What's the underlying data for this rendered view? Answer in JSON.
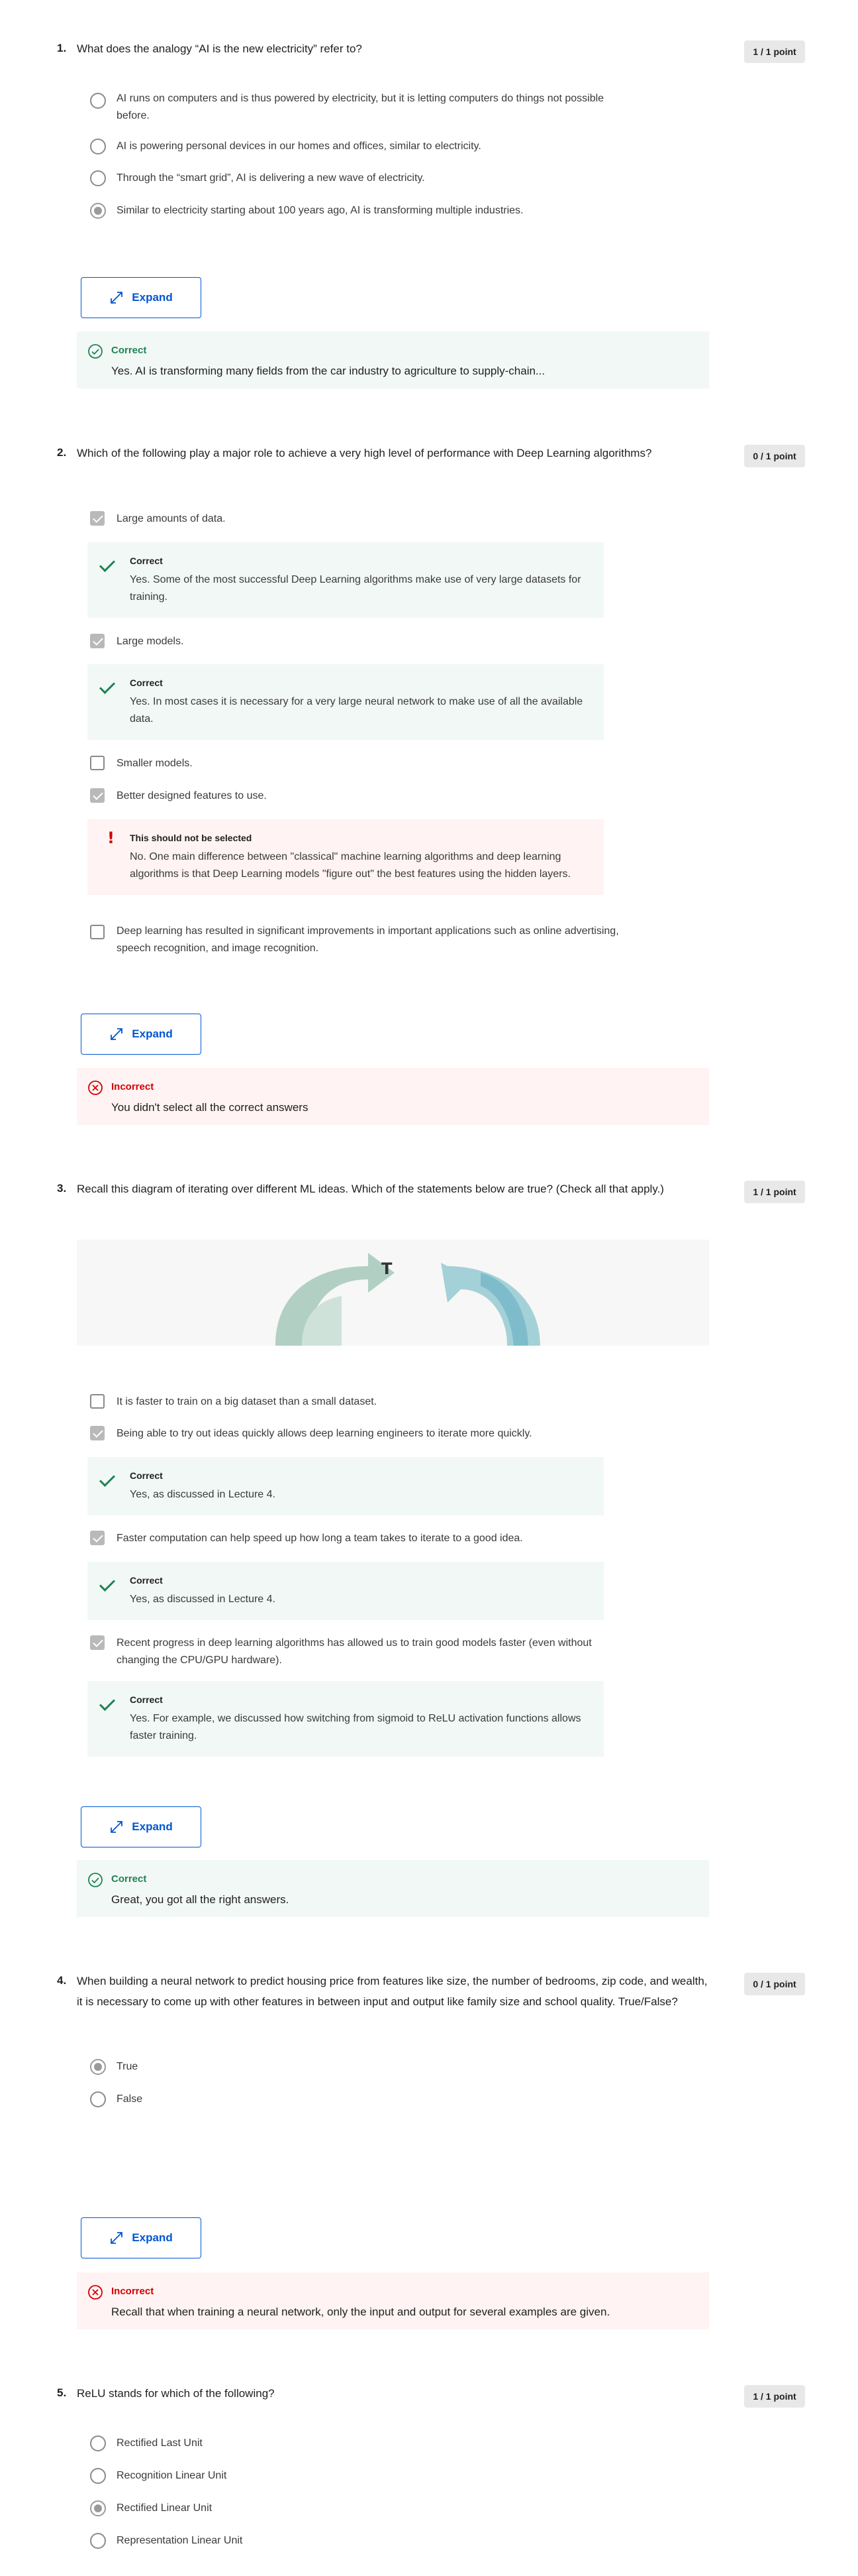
{
  "questions": [
    {
      "number": "1.",
      "text": "What does the analogy “AI is the new electricity” refer to?",
      "points": "1 / 1 point",
      "options": [
        "AI runs on computers and is thus powered by electricity, but it is letting computers do things not possible before.",
        "AI is powering personal devices in our homes and offices, similar to electricity.",
        "Through the “smart grid”, AI is delivering a new wave of electricity.",
        "Similar to electricity starting about 100 years ago, AI is transforming multiple industries."
      ],
      "expand_label": "Expand",
      "result_title": "Correct",
      "result_text": "Yes. AI is transforming many fields from the car industry to agriculture to supply-chain..."
    },
    {
      "number": "2.",
      "text": "Which of the following play a major role to achieve a very high level of performance with Deep Learning algorithms?",
      "points": "0 / 1 point",
      "options": [
        "Large amounts of data.",
        "Large models.",
        "Smaller models.",
        "Better designed features to use.",
        "Deep learning has resulted in significant improvements in important applications such as online advertising, speech recognition, and image recognition."
      ],
      "feedback": [
        {
          "title": "Correct",
          "text": "Yes. Some of the most successful Deep Learning algorithms make use of very large datasets for training."
        },
        {
          "title": "Correct",
          "text": "Yes. In most cases it is necessary for a very large neural network to make use of all the available data."
        },
        {
          "title": "This should not be selected",
          "text": "No. One main difference between \"classical\" machine learning algorithms and deep learning algorithms is that Deep Learning models \"figure out\" the best features using the hidden layers."
        }
      ],
      "expand_label": "Expand",
      "result_title": "Incorrect",
      "result_text": "You didn't select all the correct answers"
    },
    {
      "number": "3.",
      "text": "Recall this diagram of iterating over different ML ideas. Which of the statements below are true? (Check all that apply.)",
      "points": "1 / 1 point",
      "diagram_glyph": "T",
      "options": [
        "It is faster to train on a big dataset than a small dataset.",
        "Being able to try out ideas quickly allows deep learning engineers to iterate more quickly.",
        "Faster computation can help speed up how long a team takes to iterate to a good idea.",
        "Recent progress in deep learning algorithms has allowed us to train good models faster (even without changing the CPU/GPU hardware)."
      ],
      "feedback": [
        {
          "title": "Correct",
          "text": "Yes, as discussed in Lecture 4."
        },
        {
          "title": "Correct",
          "text": "Yes, as discussed in Lecture 4."
        },
        {
          "title": "Correct",
          "text": "Yes. For example, we discussed how switching from sigmoid to ReLU activation functions allows faster training."
        }
      ],
      "expand_label": "Expand",
      "result_title": "Correct",
      "result_text": "Great, you got all the right answers."
    },
    {
      "number": "4.",
      "text": "When building a neural network to predict housing price from features like size, the number of bedrooms, zip code, and wealth, it is necessary to come up with other features in between input and output like family size and school quality. True/False?",
      "points": "0 / 1 point",
      "options": [
        "True",
        "False"
      ],
      "expand_label": "Expand",
      "result_title": "Incorrect",
      "result_text": "Recall that when training a neural network, only the input and output for several examples are given."
    },
    {
      "number": "5.",
      "text": "ReLU stands for which of the following?",
      "points": "1 / 1 point",
      "options": [
        "Rectified Last Unit",
        "Recognition Linear Unit",
        "Rectified Linear Unit",
        "Representation Linear Unit"
      ]
    }
  ],
  "colors": {
    "correct": "#1f8354",
    "incorrect": "#d30001",
    "link": "#0056d2"
  },
  "icons": {
    "expand": "expand-arrows-icon",
    "correct": "check-circle-icon",
    "incorrect": "x-circle-icon",
    "warning": "exclamation-icon"
  }
}
